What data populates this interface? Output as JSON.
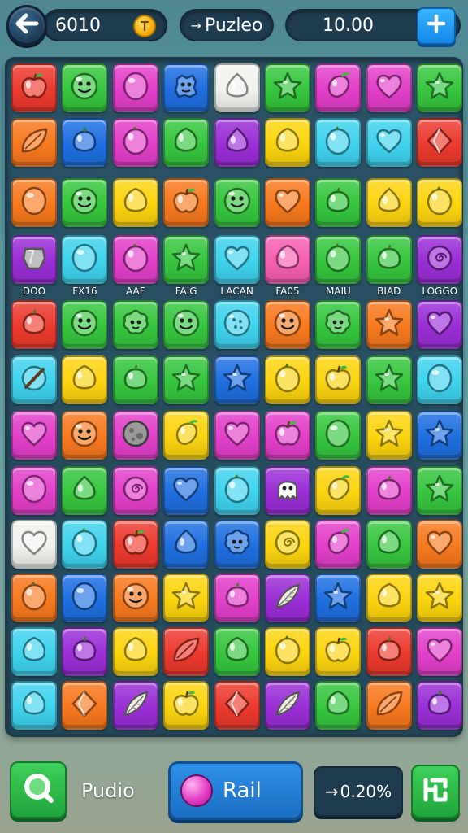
{
  "top_bar": {
    "score": "6010",
    "level_label": "Puzleo",
    "coins": "10.00"
  },
  "board": {
    "palette": {
      "red": "#ec3a2e",
      "orange": "#f7791e",
      "yellow": "#fbd40f",
      "green": "#36c63e",
      "cyan": "#3fd3ee",
      "blue": "#1f6fe0",
      "purple": "#9a2ed6",
      "magenta": "#e23fc9",
      "pink": "#f55fb2",
      "white": "#f1f1ee"
    },
    "column_labels": [
      "DOO",
      "FX16",
      "AAF",
      "FAIG",
      "LACAN",
      "FA05",
      "MAIU",
      "BIAD",
      "LOGGO"
    ],
    "rows": [
      [
        [
          "red",
          "apple"
        ],
        [
          "green",
          "face"
        ],
        [
          "magenta",
          "gem"
        ],
        [
          "blue",
          "cookie"
        ],
        [
          "white",
          "drop"
        ],
        [
          "green",
          "star"
        ],
        [
          "magenta",
          "mango"
        ],
        [
          "magenta",
          "heart"
        ],
        [
          "green",
          "star"
        ]
      ],
      [
        [
          "orange",
          "leaf"
        ],
        [
          "blue",
          "plum"
        ],
        [
          "magenta",
          "lemon"
        ],
        [
          "green",
          "lime"
        ],
        [
          "purple",
          "drop"
        ],
        [
          "yellow",
          "lime"
        ],
        [
          "cyan",
          "lemon"
        ],
        [
          "cyan",
          "heart"
        ],
        [
          "red",
          "diamond"
        ]
      ],
      [
        [
          "orange",
          "gem"
        ],
        [
          "green",
          "face"
        ],
        [
          "yellow",
          "lime"
        ],
        [
          "orange",
          "apple"
        ],
        [
          "green",
          "face"
        ],
        [
          "orange",
          "heart"
        ],
        [
          "green",
          "plum"
        ],
        [
          "yellow",
          "drop"
        ],
        [
          "yellow",
          "lemon"
        ]
      ],
      [
        [
          "purple",
          "shield"
        ],
        [
          "cyan",
          "gem"
        ],
        [
          "magenta",
          "lemon"
        ],
        [
          "green",
          "star"
        ],
        [
          "cyan",
          "heart"
        ],
        [
          "pink",
          "lime"
        ],
        [
          "green",
          "lemon"
        ],
        [
          "green",
          "plum"
        ],
        [
          "purple",
          "swirl"
        ]
      ],
      [
        [
          "red",
          "plum"
        ],
        [
          "green",
          "face"
        ],
        [
          "green",
          "flower"
        ],
        [
          "green",
          "face"
        ],
        [
          "cyan",
          "dots"
        ],
        [
          "orange",
          "face"
        ],
        [
          "green",
          "flower"
        ],
        [
          "orange",
          "star"
        ],
        [
          "purple",
          "heart"
        ]
      ],
      [
        [
          "cyan",
          "stick"
        ],
        [
          "yellow",
          "lime"
        ],
        [
          "green",
          "plum"
        ],
        [
          "green",
          "star"
        ],
        [
          "blue",
          "star"
        ],
        [
          "yellow",
          "lemon"
        ],
        [
          "yellow",
          "apple"
        ],
        [
          "green",
          "star"
        ],
        [
          "cyan",
          "gem"
        ]
      ],
      [
        [
          "magenta",
          "heart"
        ],
        [
          "orange",
          "face"
        ],
        [
          "magenta",
          "moon"
        ],
        [
          "yellow",
          "mango"
        ],
        [
          "magenta",
          "heart"
        ],
        [
          "magenta",
          "apple"
        ],
        [
          "green",
          "gem"
        ],
        [
          "yellow",
          "star"
        ],
        [
          "blue",
          "star"
        ]
      ],
      [
        [
          "magenta",
          "gem"
        ],
        [
          "green",
          "drop"
        ],
        [
          "magenta",
          "swirl"
        ],
        [
          "blue",
          "heart"
        ],
        [
          "cyan",
          "lemon"
        ],
        [
          "purple",
          "ghost"
        ],
        [
          "yellow",
          "mango"
        ],
        [
          "magenta",
          "plum"
        ],
        [
          "green",
          "star"
        ]
      ],
      [
        [
          "white",
          "heart"
        ],
        [
          "cyan",
          "lemon"
        ],
        [
          "red",
          "apple"
        ],
        [
          "blue",
          "drop"
        ],
        [
          "blue",
          "flower"
        ],
        [
          "yellow",
          "swirl"
        ],
        [
          "magenta",
          "mango"
        ],
        [
          "green",
          "lime"
        ],
        [
          "orange",
          "heart"
        ]
      ],
      [
        [
          "orange",
          "lemon"
        ],
        [
          "blue",
          "gem"
        ],
        [
          "orange",
          "face"
        ],
        [
          "yellow",
          "star"
        ],
        [
          "magenta",
          "plum"
        ],
        [
          "purple",
          "feather"
        ],
        [
          "blue",
          "star"
        ],
        [
          "yellow",
          "lime"
        ],
        [
          "yellow",
          "star"
        ]
      ],
      [
        [
          "cyan",
          "lime"
        ],
        [
          "purple",
          "plum"
        ],
        [
          "yellow",
          "lime"
        ],
        [
          "red",
          "leaf"
        ],
        [
          "green",
          "lime"
        ],
        [
          "yellow",
          "lemon"
        ],
        [
          "yellow",
          "apple"
        ],
        [
          "red",
          "plum"
        ],
        [
          "magenta",
          "heart"
        ]
      ],
      [
        [
          "cyan",
          "lime"
        ],
        [
          "orange",
          "diamond"
        ],
        [
          "purple",
          "feather"
        ],
        [
          "yellow",
          "apple"
        ],
        [
          "red",
          "diamond"
        ],
        [
          "purple",
          "feather"
        ],
        [
          "green",
          "lime"
        ],
        [
          "orange",
          "leaf"
        ],
        [
          "purple",
          "plum"
        ]
      ]
    ]
  },
  "bottom_bar": {
    "profile_label": "Pudio",
    "ball_label": "Rail",
    "timer": "0.20%"
  }
}
